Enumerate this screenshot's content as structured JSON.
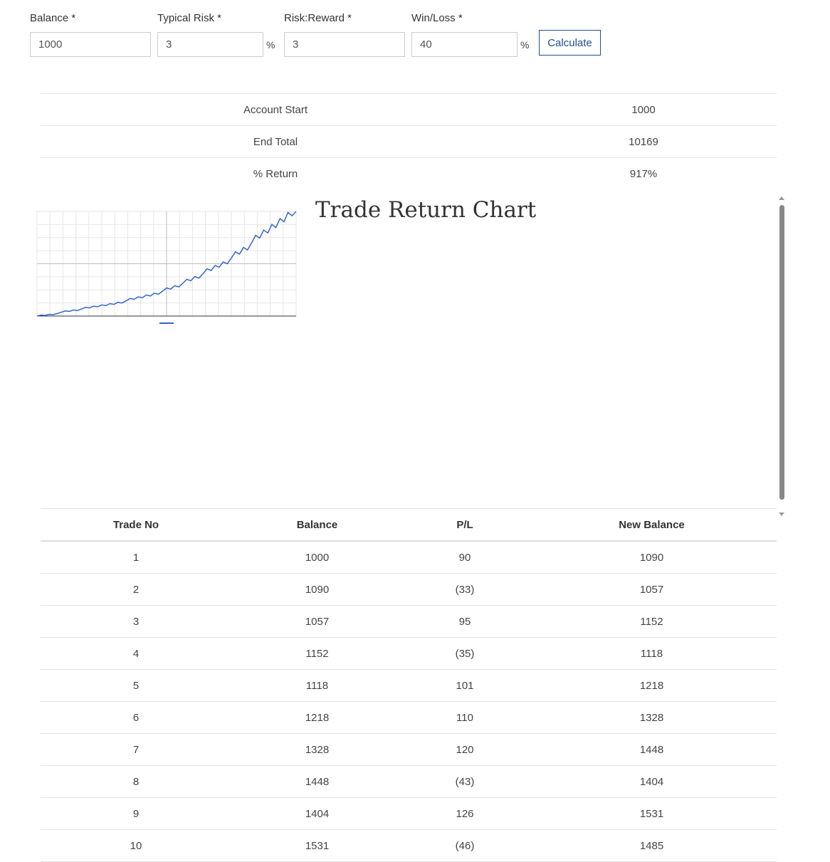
{
  "form": {
    "balance_label": "Balance *",
    "risk_label": "Typical Risk *",
    "rr_label": "Risk:Reward *",
    "wl_label": "Win/Loss *",
    "balance_value": "1000",
    "risk_value": "3",
    "rr_value": "3",
    "wl_value": "40",
    "pct_symbol": "%",
    "calculate_label": "Calculate"
  },
  "summary": {
    "rows": [
      {
        "label": "Account Start",
        "value": "1000"
      },
      {
        "label": "End Total",
        "value": "10169"
      },
      {
        "label": "% Return",
        "value": "917%"
      }
    ]
  },
  "chart_title": "Trade Return Chart",
  "colors": {
    "line": "#3366cc",
    "grid": "#e6e6e6",
    "axis": "#333333",
    "accent": "#1f4e8c"
  },
  "chart_data": {
    "type": "line",
    "title": "Trade Return Chart",
    "xlabel": "",
    "ylabel": "",
    "xlim": [
      0,
      100
    ],
    "ylim": [
      1000,
      10169
    ],
    "grid": true,
    "x": [
      0,
      2,
      3,
      4,
      5,
      6,
      7,
      8,
      9,
      10,
      11,
      12,
      13,
      14,
      15,
      16,
      17,
      18,
      19,
      20,
      21,
      22,
      23,
      24,
      25,
      26,
      27,
      28,
      29,
      30,
      31,
      32,
      33,
      34,
      35,
      36,
      37,
      38,
      39,
      40,
      41,
      42,
      43,
      44,
      45,
      46,
      47,
      48,
      49,
      50,
      51,
      52,
      53,
      54,
      55,
      56,
      57,
      58,
      59,
      60,
      61,
      62,
      63,
      64,
      65,
      66,
      67,
      68,
      69,
      70,
      71,
      72,
      73,
      74,
      75,
      76,
      77,
      78,
      79,
      80,
      81,
      82,
      83,
      84,
      85,
      86,
      87,
      88,
      89,
      90,
      91,
      92,
      93,
      94,
      95,
      96,
      97,
      98,
      99,
      100
    ],
    "series": [
      {
        "values": [
          1000,
          1090,
          1057,
          1152,
          1118,
          1218,
          1328,
          1448,
          1404,
          1531,
          1485,
          1619,
          1763,
          1710,
          1865,
          1809,
          1972,
          1913,
          2085,
          2022,
          2205,
          2139,
          2331,
          2541,
          2465,
          2687,
          2606,
          2841,
          2756,
          3004,
          2914,
          3176,
          3462,
          3358,
          3661,
          3551,
          3871,
          4219,
          4093,
          4461,
          4327,
          4717,
          5142,
          4988,
          5437,
          5274,
          5748,
          5576,
          6078,
          6625,
          6426,
          7005,
          6795,
          7406,
          8073,
          7831,
          8536,
          8280,
          9025,
          8754,
          9542,
          9256,
          10089,
          9787,
          10169,
          10169,
          10169,
          10169,
          10169,
          10169,
          10169,
          10169,
          10169,
          10169,
          10169,
          10169,
          10169,
          10169,
          10169,
          10169,
          10169,
          10169,
          10169,
          10169,
          10169,
          10169,
          10169,
          10169,
          10169,
          10169,
          10169,
          10169,
          10169,
          10169,
          10169,
          10169,
          10169,
          10169,
          10169,
          10169
        ]
      }
    ]
  },
  "table": {
    "headers": [
      "Trade No",
      "Balance",
      "P/L",
      "New Balance"
    ],
    "rows": [
      [
        "1",
        "1000",
        "90",
        "1090"
      ],
      [
        "2",
        "1090",
        "(33)",
        "1057"
      ],
      [
        "3",
        "1057",
        "95",
        "1152"
      ],
      [
        "4",
        "1152",
        "(35)",
        "1118"
      ],
      [
        "5",
        "1118",
        "101",
        "1218"
      ],
      [
        "6",
        "1218",
        "110",
        "1328"
      ],
      [
        "7",
        "1328",
        "120",
        "1448"
      ],
      [
        "8",
        "1448",
        "(43)",
        "1404"
      ],
      [
        "9",
        "1404",
        "126",
        "1531"
      ],
      [
        "10",
        "1531",
        "(46)",
        "1485"
      ]
    ]
  }
}
